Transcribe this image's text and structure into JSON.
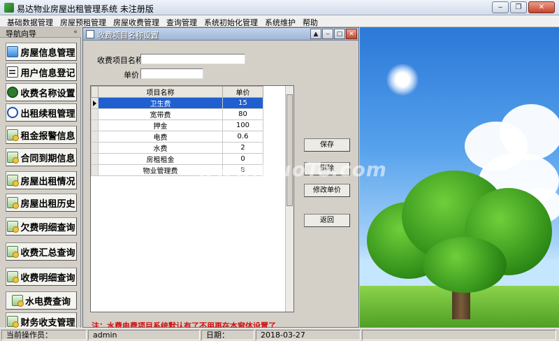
{
  "app": {
    "title": "易达物业房屋出租管理系统 未注册版"
  },
  "window_buttons": {
    "minimize": "‒",
    "restore": "❐",
    "close": "✕"
  },
  "menu": [
    "基础数据管理",
    "房屋预租管理",
    "房屋收费管理",
    "查询管理",
    "系统初始化管理",
    "系统维护",
    "帮助"
  ],
  "nav": {
    "header": "导航向导",
    "collapse": "«",
    "items": [
      {
        "label": "房屋信息管理",
        "icon": "house-icon"
      },
      {
        "label": "用户信息登记",
        "icon": "id-card-icon"
      },
      {
        "label": "收费名称设置",
        "icon": "money-bag-icon"
      },
      {
        "label": "出租续租管理",
        "icon": "cycle-icon"
      },
      {
        "label": "租金报警信息",
        "icon": "report-icon"
      },
      {
        "label": "合同到期信息",
        "icon": "report-icon"
      },
      {
        "label": "房屋出租情况",
        "icon": "report-icon"
      },
      {
        "label": "房屋出租历史",
        "icon": "report-icon"
      },
      {
        "label": "欠费明细查询",
        "icon": "report-icon"
      },
      {
        "label": "收费汇总查询",
        "icon": "report-icon"
      },
      {
        "label": "收费明细查询",
        "icon": "report-icon"
      },
      {
        "label": "水电费查询",
        "icon": "report-icon"
      },
      {
        "label": "财务收支管理",
        "icon": "report-icon"
      }
    ]
  },
  "mdi": {
    "title": "收费项目名称设置",
    "form": {
      "name_label": "收费项目名称",
      "name_value": "",
      "price_label": "单价",
      "price_value": ""
    },
    "grid": {
      "columns": [
        "项目名称",
        "单价"
      ],
      "rows": [
        {
          "name": "卫生费",
          "price": "15",
          "selected": true
        },
        {
          "name": "宽带费",
          "price": "80",
          "selected": false
        },
        {
          "name": "押金",
          "price": "100",
          "selected": false
        },
        {
          "name": "电费",
          "price": "0.6",
          "selected": false
        },
        {
          "name": "水费",
          "price": "2",
          "selected": false
        },
        {
          "name": "房租租金",
          "price": "0",
          "selected": false
        },
        {
          "name": "物业管理费",
          "price": "8",
          "selected": false
        }
      ]
    },
    "buttons": {
      "save": "保存",
      "delete": "删除",
      "edit_price": "修改单价",
      "back": "返回"
    },
    "note": "注：水费电费项目系统默认有了不用再在本窗体设置了"
  },
  "watermark": "www.DuoTe.com",
  "status": {
    "operator_label": "当前操作员：",
    "operator_value": "admin",
    "date_label": "日期：",
    "date_value": "2018-03-27"
  }
}
